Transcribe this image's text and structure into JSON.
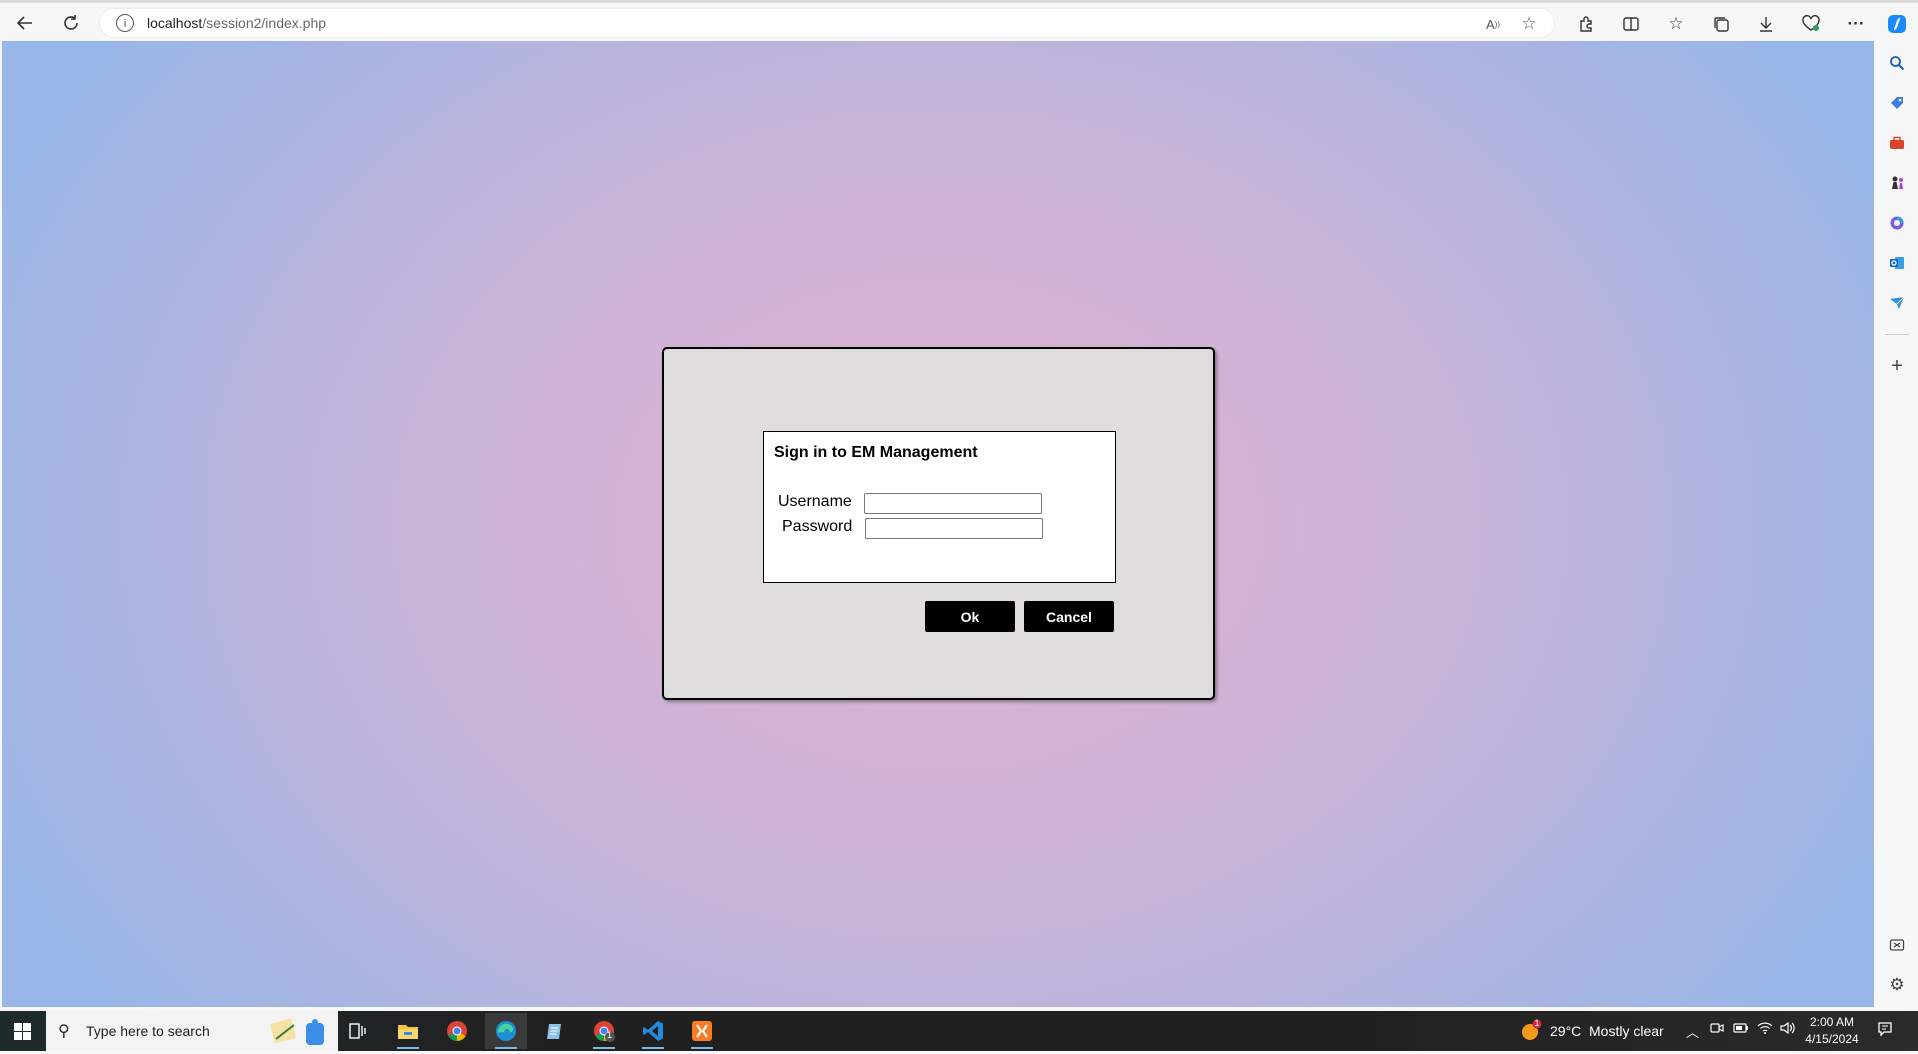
{
  "browser": {
    "url_host": "localhost",
    "url_path": "/session2/index.php",
    "back_icon": "back-arrow-icon",
    "refresh_icon": "refresh-icon",
    "read_aloud_icon": "read-aloud-icon",
    "favorite_icon": "star-icon"
  },
  "login": {
    "title": "Sign in to EM Management",
    "username_label": "Username",
    "password_label": "Password",
    "username_value": "",
    "password_value": "",
    "ok_label": "Ok",
    "cancel_label": "Cancel"
  },
  "taskbar": {
    "search_placeholder": "Type here to search",
    "weather_temp": "29°C",
    "weather_text": "Mostly clear",
    "weather_badge": "1",
    "time": "2:00 AM",
    "date": "4/15/2024",
    "chrome_badge": "1"
  },
  "colors": {
    "accent": "#76b9ed",
    "button_bg": "#000000",
    "dialog_bg": "#dedcdc"
  }
}
